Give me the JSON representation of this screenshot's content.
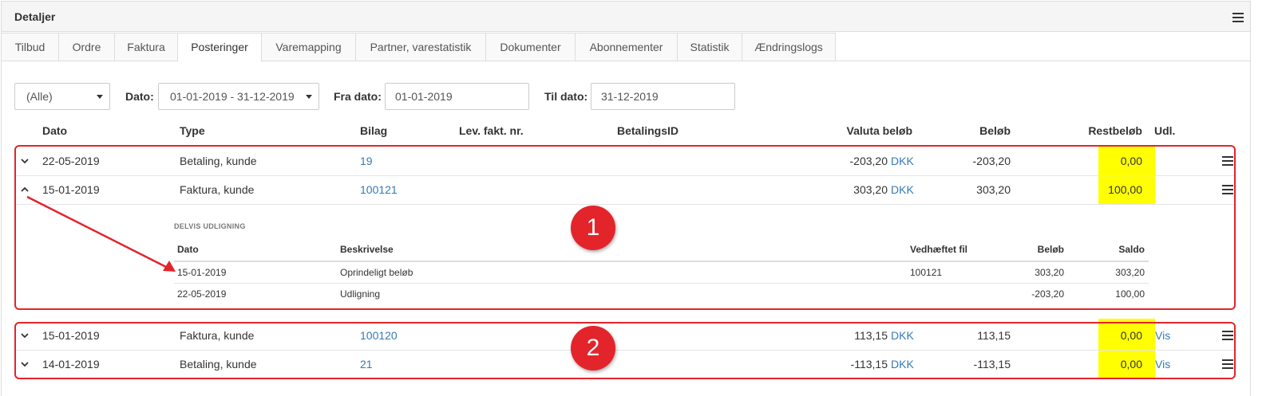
{
  "panel": {
    "title": "Detaljer"
  },
  "tabs": [
    {
      "label": "Tilbud"
    },
    {
      "label": "Ordre"
    },
    {
      "label": "Faktura"
    },
    {
      "label": "Posteringer"
    },
    {
      "label": "Varemapping"
    },
    {
      "label": "Partner, varestatistik"
    },
    {
      "label": "Dokumenter"
    },
    {
      "label": "Abonnementer"
    },
    {
      "label": "Statistik"
    },
    {
      "label": "Ændringslogs"
    }
  ],
  "active_tab": "Posteringer",
  "filters": {
    "scope_value": "(Alle)",
    "date_label": "Dato:",
    "date_value": "01-01-2019 - 31-12-2019",
    "from_label": "Fra dato:",
    "from_value": "01-01-2019",
    "to_label": "Til dato:",
    "to_value": "31-12-2019"
  },
  "columns": {
    "dato": "Dato",
    "type": "Type",
    "bilag": "Bilag",
    "lev": "Lev. fakt. nr.",
    "betalingsid": "BetalingsID",
    "valuta": "Valuta beløb",
    "belob": "Beløb",
    "rest": "Restbeløb",
    "udl": "Udl."
  },
  "rows": [
    {
      "date": "22-05-2019",
      "type": "Betaling, kunde",
      "bilag": "19",
      "valuta": "-203,20",
      "currency": "DKK",
      "amount": "-203,20",
      "rest": "0,00",
      "udl": "",
      "expanded": false
    },
    {
      "date": "15-01-2019",
      "type": "Faktura, kunde",
      "bilag": "100121",
      "valuta": "303,20",
      "currency": "DKK",
      "amount": "303,20",
      "rest": "100,00",
      "udl": "",
      "expanded": true
    },
    {
      "date": "15-01-2019",
      "type": "Faktura, kunde",
      "bilag": "100120",
      "valuta": "113,15",
      "currency": "DKK",
      "amount": "113,15",
      "rest": "0,00",
      "udl": "Vis",
      "expanded": false
    },
    {
      "date": "14-01-2019",
      "type": "Betaling, kunde",
      "bilag": "21",
      "valuta": "-113,15",
      "currency": "DKK",
      "amount": "-113,15",
      "rest": "0,00",
      "udl": "Vis",
      "expanded": false
    }
  ],
  "partial": {
    "title": "DELVIS UDLIGNING",
    "columns": {
      "dato": "Dato",
      "beskrivelse": "Beskrivelse",
      "fil": "Vedhæftet fil",
      "belob": "Beløb",
      "saldo": "Saldo"
    },
    "rows": [
      {
        "date": "15-01-2019",
        "desc": "Oprindeligt beløb",
        "file": "100121",
        "amount": "303,20",
        "saldo": "303,20"
      },
      {
        "date": "22-05-2019",
        "desc": "Udligning",
        "file": "",
        "amount": "-203,20",
        "saldo": "100,00"
      }
    ]
  },
  "annotations": {
    "badge1": "1",
    "badge2": "2"
  },
  "colors": {
    "highlight": "#ffff00",
    "annotation_red": "#e3242b",
    "link": "#337ab7"
  },
  "icons": {
    "menu": "hamburger-icon",
    "expand": "chevron-down-icon",
    "collapse": "chevron-up-icon",
    "dropdown": "caret-down-icon"
  }
}
